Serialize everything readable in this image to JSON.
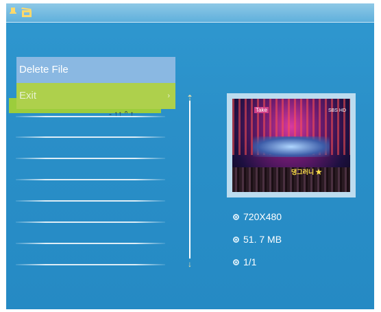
{
  "topbar": {
    "icons": [
      "pin-icon",
      "film-icon"
    ]
  },
  "menu": {
    "items": [
      {
        "label": "Delete File"
      },
      {
        "label": "Exit",
        "has_submenu": true
      }
    ]
  },
  "list": {
    "selected_text_fragment": "- ↑↑ ᐢ ↑"
  },
  "info": {
    "resolution": "720X480",
    "size": "51. 7 MB",
    "page": "1/1"
  },
  "thumbnail": {
    "badge": "Take",
    "corner": "SBS HD",
    "caption": "댕그러니 ★"
  },
  "colors": {
    "screen_bg": "#2a8fc8",
    "menu_highlight": "#8ab8e2",
    "menu_exit": "#aed04c",
    "row_highlight": "#9ccd3c"
  }
}
